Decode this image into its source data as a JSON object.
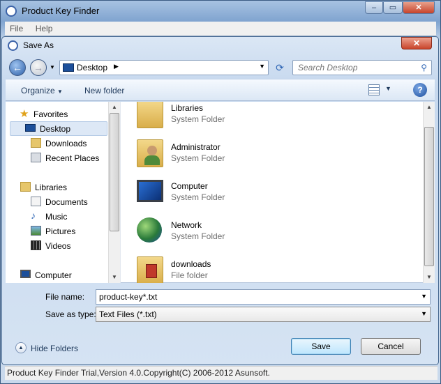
{
  "parent": {
    "title": "Product Key Finder",
    "menu": [
      "File",
      "Help"
    ],
    "status": "Product Key Finder Trial,Version 4.0.Copyright(C) 2006-2012 Asunsoft."
  },
  "dialog": {
    "title": "Save As",
    "address": {
      "current": "Desktop"
    },
    "search": {
      "placeholder": "Search Desktop"
    },
    "toolbar": {
      "organize": "Organize",
      "new_folder": "New folder"
    },
    "nav": [
      {
        "label": "Favorites",
        "icon": "star-icon"
      },
      {
        "label": "Desktop",
        "icon": "desktop-icon",
        "selected": true
      },
      {
        "label": "Downloads",
        "icon": "downloads-icon"
      },
      {
        "label": "Recent Places",
        "icon": "recent-places-icon"
      },
      {
        "label": "Libraries",
        "icon": "libraries-icon"
      },
      {
        "label": "Documents",
        "icon": "documents-icon"
      },
      {
        "label": "Music",
        "icon": "music-icon"
      },
      {
        "label": "Pictures",
        "icon": "pictures-icon"
      },
      {
        "label": "Videos",
        "icon": "videos-icon"
      },
      {
        "label": "Computer",
        "icon": "computer-icon"
      }
    ],
    "files": [
      {
        "name": "Libraries",
        "type": "System Folder",
        "icon": "libraries-folder-icon"
      },
      {
        "name": "Administrator",
        "type": "System Folder",
        "icon": "user-folder-icon"
      },
      {
        "name": "Computer",
        "type": "System Folder",
        "icon": "computer-icon"
      },
      {
        "name": "Network",
        "type": "System Folder",
        "icon": "network-icon"
      },
      {
        "name": "downloads",
        "type": "File folder",
        "icon": "folder-icon"
      }
    ],
    "filename": {
      "label": "File name:",
      "value": "product-key*.txt"
    },
    "savetype": {
      "label": "Save as type:",
      "value": "Text Files (*.txt)"
    },
    "hide_folders": "Hide Folders",
    "save": "Save",
    "cancel": "Cancel"
  },
  "colors": {
    "accent": "#2c5fa8",
    "selection": "#dde8f6",
    "title_bar": "#7fa3cf"
  }
}
